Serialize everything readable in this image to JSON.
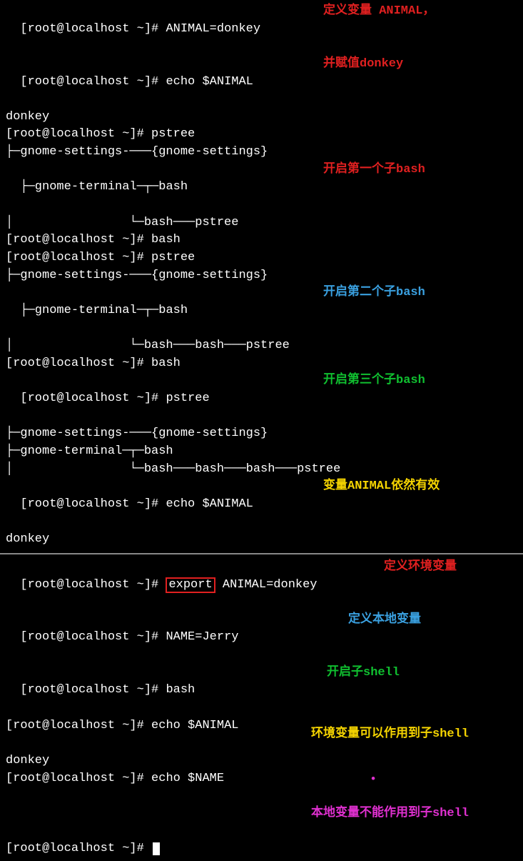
{
  "top": {
    "lines": [
      {
        "prompt": "[root@localhost ~]# ",
        "cmd": "ANIMAL=donkey"
      },
      {
        "prompt": "[root@localhost ~]# ",
        "cmd": "echo $ANIMAL"
      },
      {
        "out": "donkey"
      },
      {
        "prompt": "[root@localhost ~]# ",
        "cmd": "pstree"
      },
      {
        "out": "├─gnome-settings-───{gnome-settings}"
      },
      {
        "out": "├─gnome-terminal─┬─bash"
      },
      {
        "out": "│                └─bash───pstree"
      },
      {
        "prompt": "[root@localhost ~]# ",
        "cmd": "bash"
      },
      {
        "prompt": "[root@localhost ~]# ",
        "cmd": "pstree"
      },
      {
        "out": "├─gnome-settings-───{gnome-settings}"
      },
      {
        "out": "├─gnome-terminal─┬─bash"
      },
      {
        "out": "│                └─bash───bash───pstree"
      },
      {
        "prompt": "[root@localhost ~]# ",
        "cmd": "bash"
      },
      {
        "prompt": "[root@localhost ~]# ",
        "cmd": "pstree"
      },
      {
        "out": "├─gnome-settings-───{gnome-settings}"
      },
      {
        "out": "├─gnome-terminal─┬─bash"
      },
      {
        "out": "│                └─bash───bash───bash───pstree"
      },
      {
        "prompt": "[root@localhost ~]# ",
        "cmd": "echo $ANIMAL"
      },
      {
        "out": "donkey"
      }
    ],
    "annotations": {
      "a1_l1": "定义变量 ANIMAL，",
      "a1_l2": "并赋值donkey",
      "a2": "开启第一个子bash",
      "a3": "开启第二个子bash",
      "a4": "开启第三个子bash",
      "a5": "变量ANIMAL依然有效"
    }
  },
  "bottom": {
    "lines": [
      {
        "prompt": "[root@localhost ~]# ",
        "pre": "",
        "box": "export",
        "post": " ANIMAL=donkey"
      },
      {
        "prompt": "[root@localhost ~]# ",
        "cmd": "NAME=Jerry"
      },
      {
        "prompt": "[root@localhost ~]# ",
        "cmd": "bash"
      },
      {
        "prompt": "[root@localhost ~]# ",
        "cmd": "echo $ANIMAL"
      },
      {
        "out": "donkey"
      },
      {
        "prompt": "[root@localhost ~]# ",
        "cmd": "echo $NAME"
      },
      {
        "out": " "
      },
      {
        "prompt": "[root@localhost ~]# ",
        "cursor": true
      }
    ],
    "annotations": {
      "b1": "定义环境变量",
      "b2": "定义本地变量",
      "b3": "开启子shell",
      "b4": "环境变量可以作用到子shell",
      "b5": "本地变量不能作用到子shell"
    }
  }
}
